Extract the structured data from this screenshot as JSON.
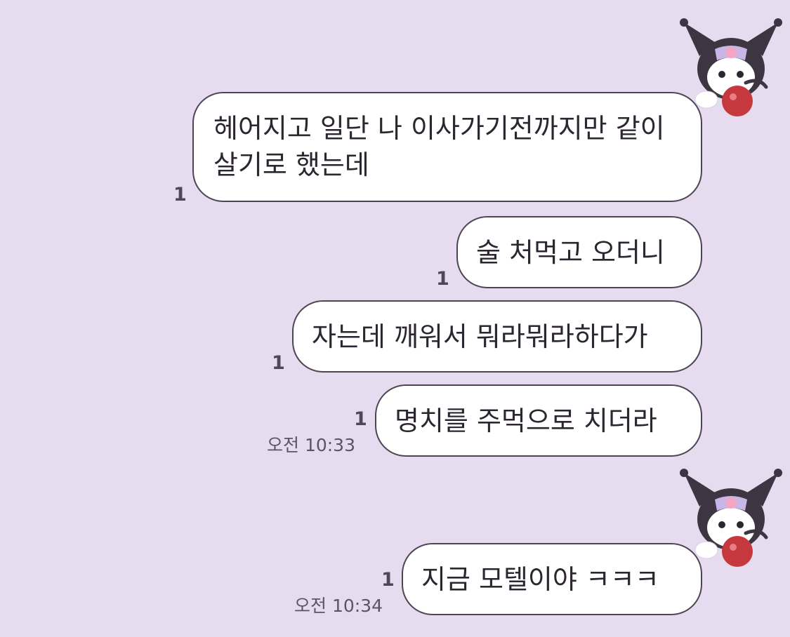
{
  "chat": {
    "messages": [
      {
        "text": "헤어지고 일단 나 이사가기전까지만 같이 살기로 했는데",
        "read_count": "1",
        "time": ""
      },
      {
        "text": "술 처먹고 오더니",
        "read_count": "1",
        "time": ""
      },
      {
        "text": "자는데 깨워서 뭐라뭐라하다가",
        "read_count": "1",
        "time": ""
      },
      {
        "text": "명치를 주먹으로 치더라",
        "read_count": "1",
        "time": "오전 10:33"
      },
      {
        "text": "지금 모텔이야 ㅋㅋㅋ",
        "read_count": "1",
        "time": "오전 10:34"
      }
    ]
  },
  "avatars": [
    {
      "icon": "kuromi-avatar-icon"
    },
    {
      "icon": "kuromi-avatar-icon"
    }
  ],
  "colors": {
    "background": "#e7dcef",
    "bubble": "#ffffff",
    "bubble_border": "#4d4454",
    "text": "#2b262f",
    "meta": "#5c5464"
  }
}
